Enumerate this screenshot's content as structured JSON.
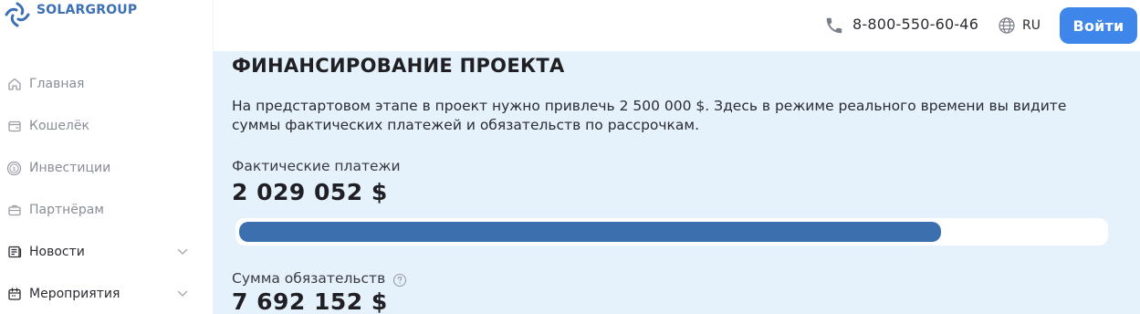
{
  "brand": {
    "name": "SOLARGROUP",
    "color": "#3d6fb5"
  },
  "sidebar": {
    "items": [
      {
        "label": "Главная",
        "icon": "home-icon",
        "style": "muted",
        "has_chevron": false
      },
      {
        "label": "Кошелёк",
        "icon": "wallet-icon",
        "style": "muted",
        "has_chevron": false
      },
      {
        "label": "Инвестиции",
        "icon": "coin-icon",
        "style": "muted",
        "has_chevron": false
      },
      {
        "label": "Партнёрам",
        "icon": "briefcase-icon",
        "style": "muted",
        "has_chevron": false
      },
      {
        "label": "Новости",
        "icon": "newspaper-icon",
        "style": "strong",
        "has_chevron": true
      },
      {
        "label": "Мероприятия",
        "icon": "calendar-icon",
        "style": "strong",
        "has_chevron": true
      }
    ]
  },
  "header": {
    "phone": "8-800-550-60-46",
    "language": "RU",
    "login_label": "Войти",
    "accent": "#3f86ea"
  },
  "main": {
    "title": "ФИНАНСИРОВАНИЕ ПРОЕКТА",
    "description": "На предстартовом этапе в проект нужно привлечь 2 500 000 $. Здесь в режиме реального времени вы видите суммы фактических платежей и обязательств по рассрочкам.",
    "fact_label": "Фактические платежи",
    "fact_value": "2 029 052 $",
    "progress_fraction": 0.8116,
    "progress_color": "#3c6fae",
    "sum_label": "Сумма обязательств",
    "sum_value": "7 692 152 $",
    "background": "#e5f1fb"
  }
}
